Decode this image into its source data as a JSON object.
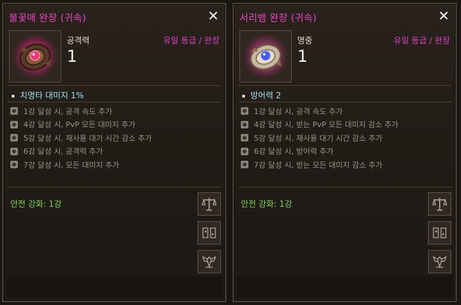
{
  "panels": [
    {
      "title": "불꽃매 완장 (귀속)",
      "stat_name": "공격력",
      "stat_value": "1",
      "grade": "유일 등급 / 완장",
      "option": "치명타 대미지 1%",
      "set_bonuses": [
        "1강 달성 시, 공격 속도 추가",
        "4강 달성 시, PvP 모든 대미지 추가",
        "5강 달성 시, 재사용 대기 시간 감소 추가",
        "6강 달성 시, 공격력 추가",
        "7강 달성 시, 모든 대미지 추가"
      ],
      "safe_enhance": "안전 강화: 1강",
      "gem_color": "#e83a7a"
    },
    {
      "title": "서리뱀 완장 (귀속)",
      "stat_name": "명중",
      "stat_value": "1",
      "grade": "유일 등급 / 완장",
      "option": "방어력 2",
      "set_bonuses": [
        "1강 달성 시, 공격 속도 추가",
        "4강 달성 시, 받는 PvP 모든 대미지 감소 추가",
        "5강 달성 시, 재사용 대기 시간 감소 추가",
        "6강 달성 시, 방어력 추가",
        "7강 달성 시, 받는 모든 대미지 감소 추가"
      ],
      "safe_enhance": "안전 강화: 1강",
      "gem_color": "#5a6ae8"
    }
  ],
  "icons": {
    "close": "close-icon",
    "scale": "scale-icon",
    "exchange": "exchange-icon",
    "emblem": "winged-emblem-icon"
  },
  "colors": {
    "title": "#e846c6",
    "grade": "#d846c8",
    "option": "#9fe3f0",
    "safe": "#84d45a"
  }
}
